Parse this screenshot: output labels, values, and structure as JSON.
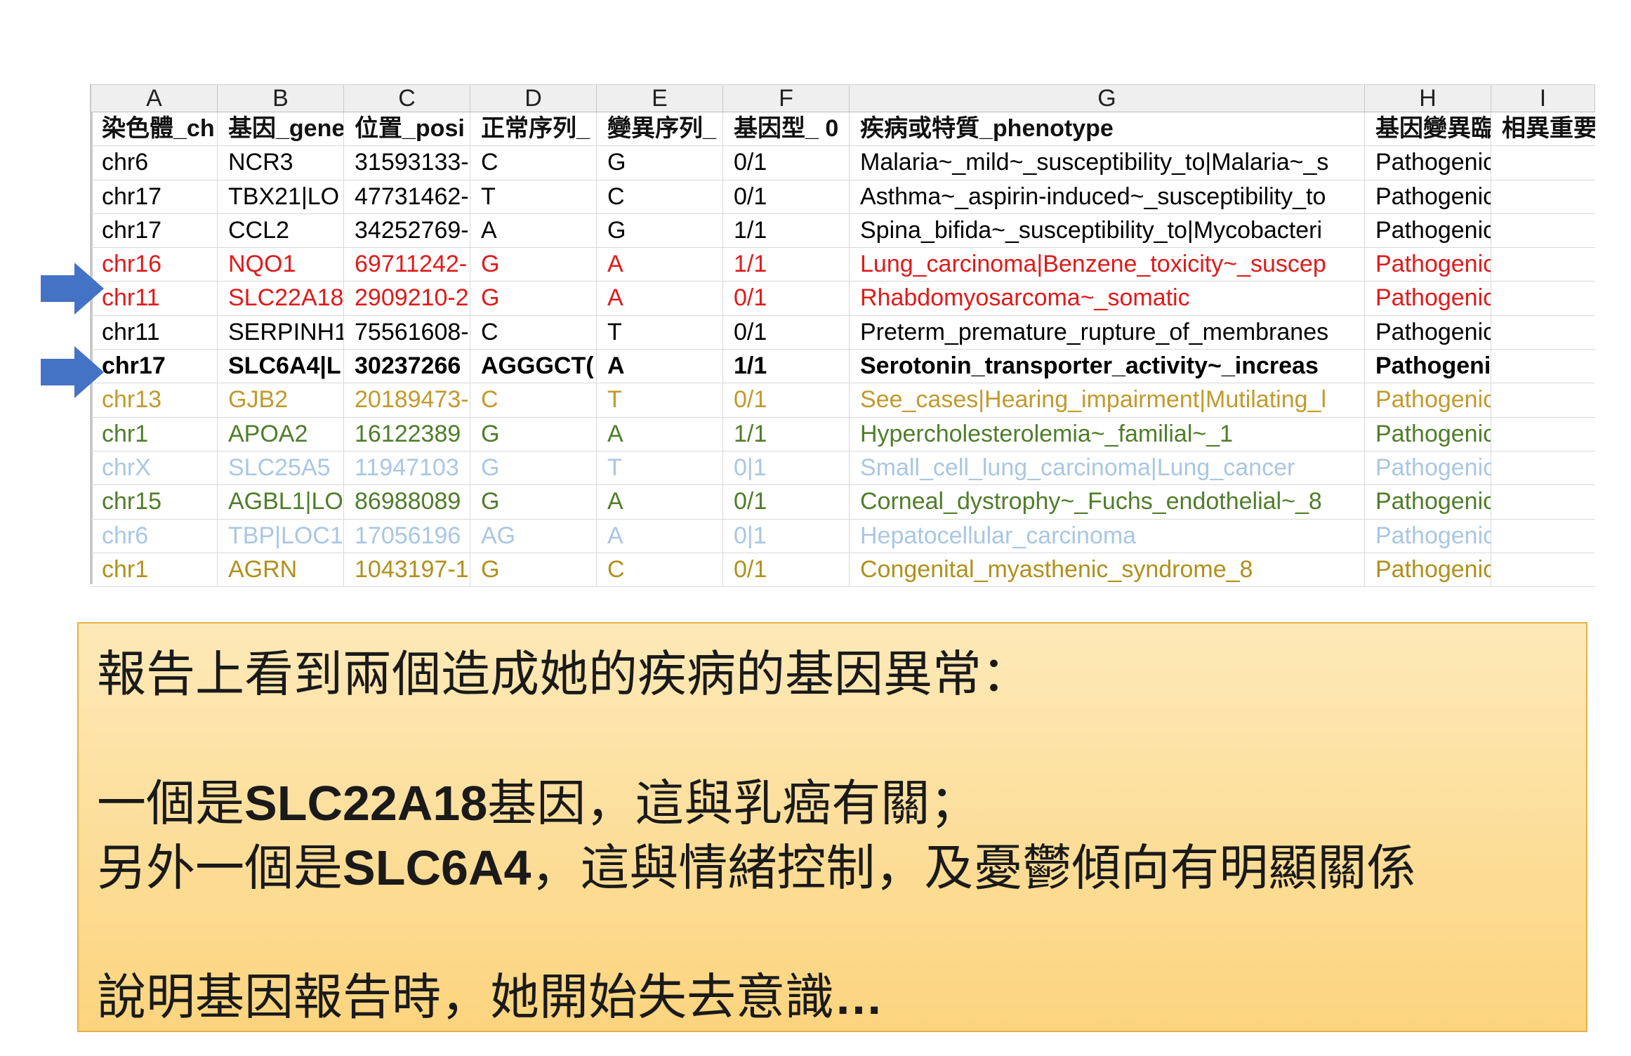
{
  "sheet": {
    "column_letters": [
      "A",
      "B",
      "C",
      "D",
      "E",
      "F",
      "G",
      "H",
      "I"
    ],
    "header": [
      "染色體_ch",
      "基因_gene",
      "位置_posi",
      "正常序列_",
      "變異序列_",
      "基因型_ 0",
      "疾病或特質_phenotype",
      "基因變異臨",
      "相異重要"
    ],
    "rows": [
      {
        "color": "#000000",
        "bold": false,
        "cells": [
          "chr6",
          "NCR3",
          "31593133-",
          "C",
          "G",
          "0/1",
          "Malaria~_mild~_susceptibility_to|Malaria~_s",
          "Pathogenic|risk_fac",
          ""
        ]
      },
      {
        "color": "#000000",
        "bold": false,
        "cells": [
          "chr17",
          "TBX21|LO",
          "47731462-",
          "T",
          "C",
          "0/1",
          "Asthma~_aspirin-induced~_susceptibility_to",
          "Pathogenic|risk_fac",
          ""
        ]
      },
      {
        "color": "#000000",
        "bold": false,
        "cells": [
          "chr17",
          "CCL2",
          "34252769-",
          "A",
          "G",
          "1/1",
          "Spina_bifida~_susceptibility_to|Mycobacteri",
          "Pathogenic|risk_fac",
          ""
        ]
      },
      {
        "color": "#e01a1a",
        "bold": false,
        "cells": [
          "chr16",
          "NQO1",
          "69711242-",
          "G",
          "A",
          "1/1",
          "Lung_carcinoma|Benzene_toxicity~_suscep",
          "Pathogenic|risk_fac",
          ""
        ]
      },
      {
        "color": "#e01a1a",
        "bold": false,
        "cells": [
          "chr11",
          "SLC22A18",
          "2909210-2",
          "G",
          "A",
          "0/1",
          "Rhabdomyosarcoma~_somatic",
          "Pathogenic",
          ""
        ]
      },
      {
        "color": "#000000",
        "bold": false,
        "cells": [
          "chr11",
          "SERPINH1",
          "75561608-",
          "C",
          "T",
          "0/1",
          "Preterm_premature_rupture_of_membranes",
          "Pathogenic",
          ""
        ]
      },
      {
        "color": "#000000",
        "bold": true,
        "cells": [
          "chr17",
          "SLC6A4|L",
          "30237266",
          "AGGGCT(",
          "A",
          "1/1",
          "Serotonin_transporter_activity~_increas",
          "Pathogenic",
          ""
        ]
      },
      {
        "color": "#c19a2c",
        "bold": false,
        "cells": [
          "chr13",
          "GJB2",
          "20189473-",
          "C",
          "T",
          "0/1",
          "See_cases|Hearing_impairment|Mutilating_l",
          "Pathogenic",
          ""
        ]
      },
      {
        "color": "#4f7d2a",
        "bold": false,
        "cells": [
          "chr1",
          "APOA2",
          "16122389",
          "G",
          "A",
          "1/1",
          "Hypercholesterolemia~_familial~_1",
          "Pathogenic",
          ""
        ]
      },
      {
        "color": "#a9c7e3",
        "bold": false,
        "cells": [
          "chrX",
          "SLC25A5",
          "11947103",
          "G",
          "T",
          "0|1",
          "Small_cell_lung_carcinoma|Lung_cancer",
          "Pathogenic",
          ""
        ]
      },
      {
        "color": "#4f7d2a",
        "bold": false,
        "cells": [
          "chr15",
          "AGBL1|LO",
          "86988089",
          "G",
          "A",
          "0/1",
          "Corneal_dystrophy~_Fuchs_endothelial~_8",
          "Pathogenic",
          ""
        ]
      },
      {
        "color": "#a9c7e3",
        "bold": false,
        "cells": [
          "chr6",
          "TBP|LOC1",
          "17056196",
          "AG",
          "A",
          "0|1",
          "Hepatocellular_carcinoma",
          "Pathogenic",
          ""
        ]
      },
      {
        "color": "#b0901c",
        "bold": false,
        "cells": [
          "chr1",
          "AGRN",
          "1043197-1",
          "G",
          "C",
          "0/1",
          "Congenital_myasthenic_syndrome_8",
          "Pathogenic",
          ""
        ]
      }
    ]
  },
  "arrows": {
    "color": "#4472c4"
  },
  "callout": {
    "line1": "報告上看到兩個造成她的疾病的基因異常：",
    "line2_pre": "一個是",
    "line2_gene": "SLC22A18",
    "line2_post": "基因，這與乳癌有關；",
    "line3_pre": "另外一個是",
    "line3_gene": "SLC6A4",
    "line3_post": "，這與情緒控制，及憂鬱傾向有明顯關係",
    "line4": "說明基因報告時，她開始失去意識",
    "line4_ellipsis": "…"
  }
}
